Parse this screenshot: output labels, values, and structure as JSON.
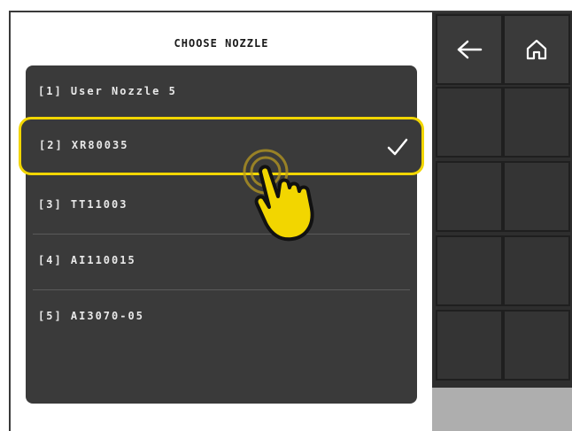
{
  "screen": {
    "title": "CHOOSE NOZZLE"
  },
  "nozzles": [
    {
      "label": "[1] User Nozzle 5",
      "selected": false
    },
    {
      "label": "[2] XR80035",
      "selected": true
    },
    {
      "label": "[3] TT11003",
      "selected": false
    },
    {
      "label": "[4] AI110015",
      "selected": false
    },
    {
      "label": "[5] AI3070-05",
      "selected": false
    }
  ],
  "toolbar": {
    "back_icon": "arrow-left-icon",
    "home_icon": "home-icon"
  },
  "colors": {
    "highlight": "#f2d600",
    "panel": "#3a3a3a",
    "text": "#e8e8e8"
  },
  "overlay": {
    "pointer_icon": "tap-hand-icon"
  }
}
